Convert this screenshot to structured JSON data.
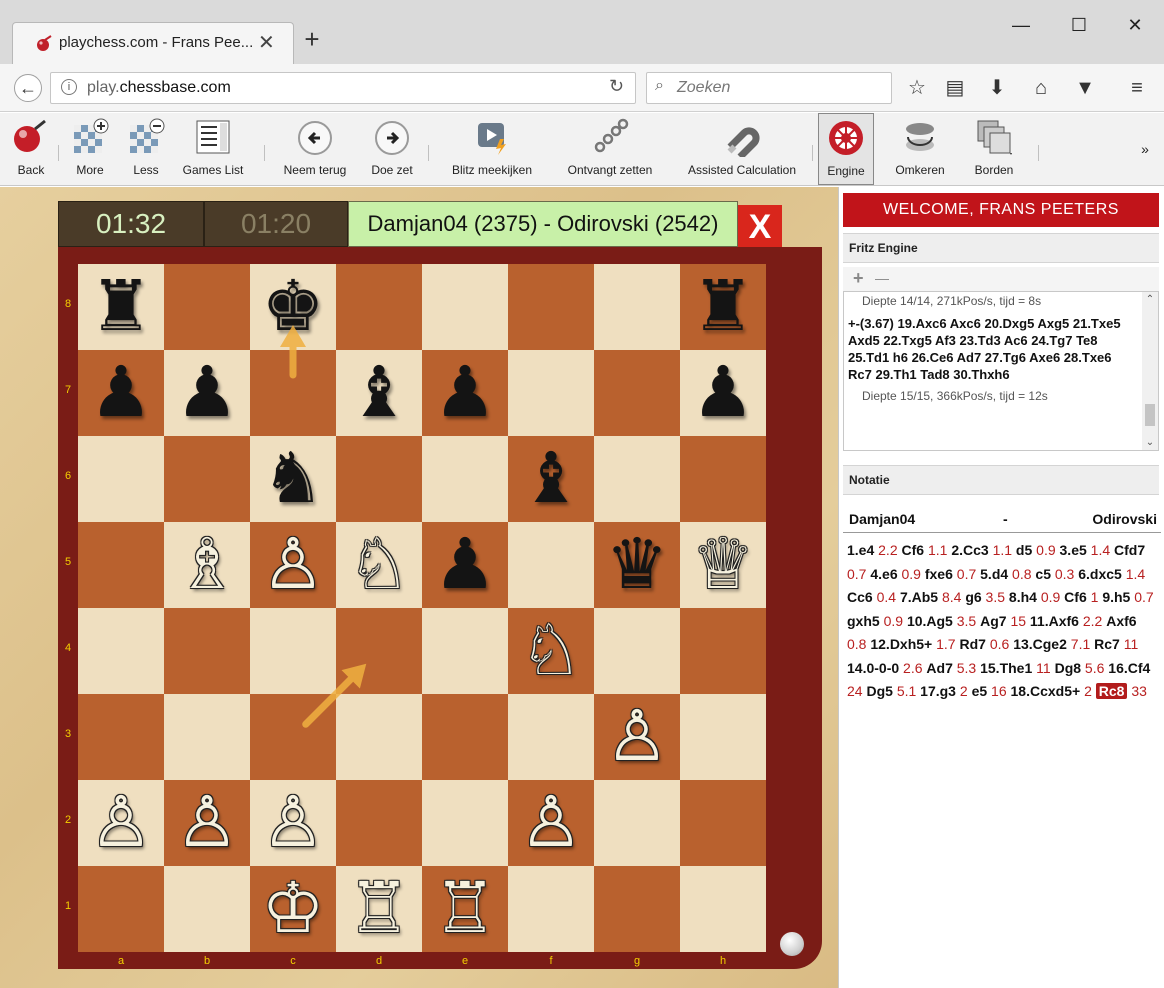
{
  "browser": {
    "tab_title": "playchess.com - Frans Pee...",
    "tab_close": "✕",
    "new_tab": "+",
    "url_prefix": "play.",
    "url_domain": "chessbase.com",
    "search_placeholder": "Zoeken",
    "window_min": "—",
    "window_max": "☐",
    "window_close": "✕"
  },
  "toolbar": {
    "back": "Back",
    "more": "More",
    "less": "Less",
    "games_list": "Games List",
    "neem_terug": "Neem terug",
    "doe_zet": "Doe zet",
    "blitz": "Blitz meekijken",
    "ontvangt": "Ontvangt zetten",
    "assisted": "Assisted Calculation",
    "engine": "Engine",
    "omkeren": "Omkeren",
    "borden": "Borden",
    "overflow": "»"
  },
  "game": {
    "clock_white": "01:32",
    "clock_black": "01:20",
    "title": "Damjan04 (2375) - Odirovski (2542)",
    "close": "X",
    "ranks": [
      "8",
      "7",
      "6",
      "5",
      "4",
      "3",
      "2",
      "1"
    ],
    "files": [
      "a",
      "b",
      "c",
      "d",
      "e",
      "f",
      "g",
      "h"
    ],
    "pieces": [
      {
        "square": "a8",
        "glyph": "♜",
        "side": "black"
      },
      {
        "square": "c8",
        "glyph": "♚",
        "side": "black"
      },
      {
        "square": "h8",
        "glyph": "♜",
        "side": "black"
      },
      {
        "square": "a7",
        "glyph": "♟",
        "side": "black"
      },
      {
        "square": "b7",
        "glyph": "♟",
        "side": "black"
      },
      {
        "square": "d7",
        "glyph": "♝",
        "side": "black"
      },
      {
        "square": "e7",
        "glyph": "♟",
        "side": "black"
      },
      {
        "square": "h7",
        "glyph": "♟",
        "side": "black"
      },
      {
        "square": "c6",
        "glyph": "♞",
        "side": "black"
      },
      {
        "square": "f6",
        "glyph": "♝",
        "side": "black"
      },
      {
        "square": "b5",
        "glyph": "♗",
        "side": "white"
      },
      {
        "square": "c5",
        "glyph": "♙",
        "side": "white"
      },
      {
        "square": "d5",
        "glyph": "♘",
        "side": "white"
      },
      {
        "square": "e5",
        "glyph": "♟",
        "side": "black"
      },
      {
        "square": "g5",
        "glyph": "♛",
        "side": "black"
      },
      {
        "square": "h5",
        "glyph": "♕",
        "side": "white"
      },
      {
        "square": "f4",
        "glyph": "♘",
        "side": "white"
      },
      {
        "square": "g3",
        "glyph": "♙",
        "side": "white"
      },
      {
        "square": "a2",
        "glyph": "♙",
        "side": "white"
      },
      {
        "square": "b2",
        "glyph": "♙",
        "side": "white"
      },
      {
        "square": "c2",
        "glyph": "♙",
        "side": "white"
      },
      {
        "square": "f2",
        "glyph": "♙",
        "side": "white"
      },
      {
        "square": "c1",
        "glyph": "♔",
        "side": "white"
      },
      {
        "square": "d1",
        "glyph": "♖",
        "side": "white"
      },
      {
        "square": "e1",
        "glyph": "♖",
        "side": "white"
      }
    ],
    "arrows": [
      {
        "from": "c7",
        "to": "c8"
      },
      {
        "from": "c3",
        "to": "d4"
      }
    ],
    "arrow_color": "#f0b040"
  },
  "panel": {
    "welcome": "WELCOME, FRANS PEETERS",
    "engine_title": "Fritz Engine",
    "engine_plus": "+",
    "engine_minus": "—",
    "depth1": "Diepte 14/14, 271kPos/s, tijd = 8s",
    "engine_line": "+-(3.67) 19.Axc6 Axc6 20.Dxg5 Axg5 21.Txe5 Axd5 22.Txg5 Af3 23.Td3 Ac6 24.Tg7 Te8 25.Td1 h6 26.Ce6 Ad7 27.Tg6 Axe6 28.Txe6 Rc7 29.Th1 Tad8 30.Thxh6",
    "depth2": "Diepte 15/15, 366kPos/s, tijd = 12s",
    "notation_title": "Notatie",
    "white_player": "Damjan04",
    "separator": "-",
    "black_player": "Odirovski",
    "moves": [
      {
        "n": "1.e4",
        "t": "2.2"
      },
      {
        "n": "Cf6",
        "t": "1.1"
      },
      {
        "n": "2.Cc3",
        "t": "1.1"
      },
      {
        "n": "d5",
        "t": "0.9"
      },
      {
        "n": "3.e5",
        "t": "1.4"
      },
      {
        "n": "Cfd7",
        "t": "0.7"
      },
      {
        "n": "4.e6",
        "t": "0.9"
      },
      {
        "n": "fxe6",
        "t": "0.7"
      },
      {
        "n": "5.d4",
        "t": "0.8"
      },
      {
        "n": "c5",
        "t": "0.3"
      },
      {
        "n": "6.dxc5",
        "t": "1.4"
      },
      {
        "n": "Cc6",
        "t": "0.4"
      },
      {
        "n": "7.Ab5",
        "t": "8.4"
      },
      {
        "n": "g6",
        "t": "3.5"
      },
      {
        "n": "8.h4",
        "t": "0.9"
      },
      {
        "n": "Cf6",
        "t": "1"
      },
      {
        "n": "9.h5",
        "t": "0.7"
      },
      {
        "n": "gxh5",
        "t": "0.9"
      },
      {
        "n": "10.Ag5",
        "t": "3.5"
      },
      {
        "n": "Ag7",
        "t": "15"
      },
      {
        "n": "11.Axf6",
        "t": "2.2"
      },
      {
        "n": "Axf6",
        "t": "0.8"
      },
      {
        "n": "12.Dxh5+",
        "t": "1.7"
      },
      {
        "n": "Rd7",
        "t": "0.6"
      },
      {
        "n": "13.Cge2",
        "t": "7.1"
      },
      {
        "n": "Rc7",
        "t": "11"
      },
      {
        "n": "14.0-0-0",
        "t": "2.6"
      },
      {
        "n": "Ad7",
        "t": "5.3"
      },
      {
        "n": "15.The1",
        "t": "11"
      },
      {
        "n": "Dg8",
        "t": "5.6"
      },
      {
        "n": "16.Cf4",
        "t": "24"
      },
      {
        "n": "Dg5",
        "t": "5.1"
      },
      {
        "n": "17.g3",
        "t": "2"
      },
      {
        "n": "e5",
        "t": "16"
      },
      {
        "n": "18.Ccxd5+",
        "t": "2"
      },
      {
        "n": "Rc8",
        "t": "33",
        "current": true
      }
    ]
  }
}
